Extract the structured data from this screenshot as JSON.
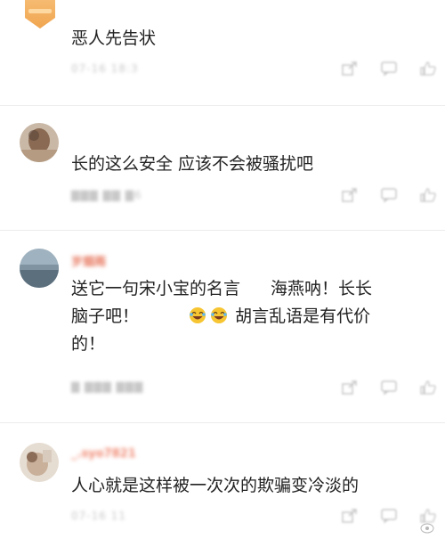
{
  "comments": [
    {
      "username": "",
      "text": "恶人先告状",
      "time": "07-16 18:3"
    },
    {
      "username": "",
      "text": "长的这么安全 应该不会被骚扰吧",
      "time": "6"
    },
    {
      "username": "岁烟雨",
      "text_part1": "送它一句宋小宝的名言",
      "text_part2": "海燕呐！长长",
      "text_part3": "脑子吧！",
      "text_part4": "胡言乱语是有代价",
      "text_part5": "的！",
      "time": ""
    },
    {
      "username": "_.syo7821",
      "text": "人心就是这样被一次次的欺骗变冷淡的",
      "time": "07-16 11"
    }
  ],
  "icons": {
    "share": "share-icon",
    "comment": "comment-icon",
    "like": "thumbs-up-icon",
    "laugh": "laughing-emoji-icon"
  },
  "colors": {
    "username": "#f08a73",
    "text": "#222222",
    "meta": "#c8c8c8"
  }
}
